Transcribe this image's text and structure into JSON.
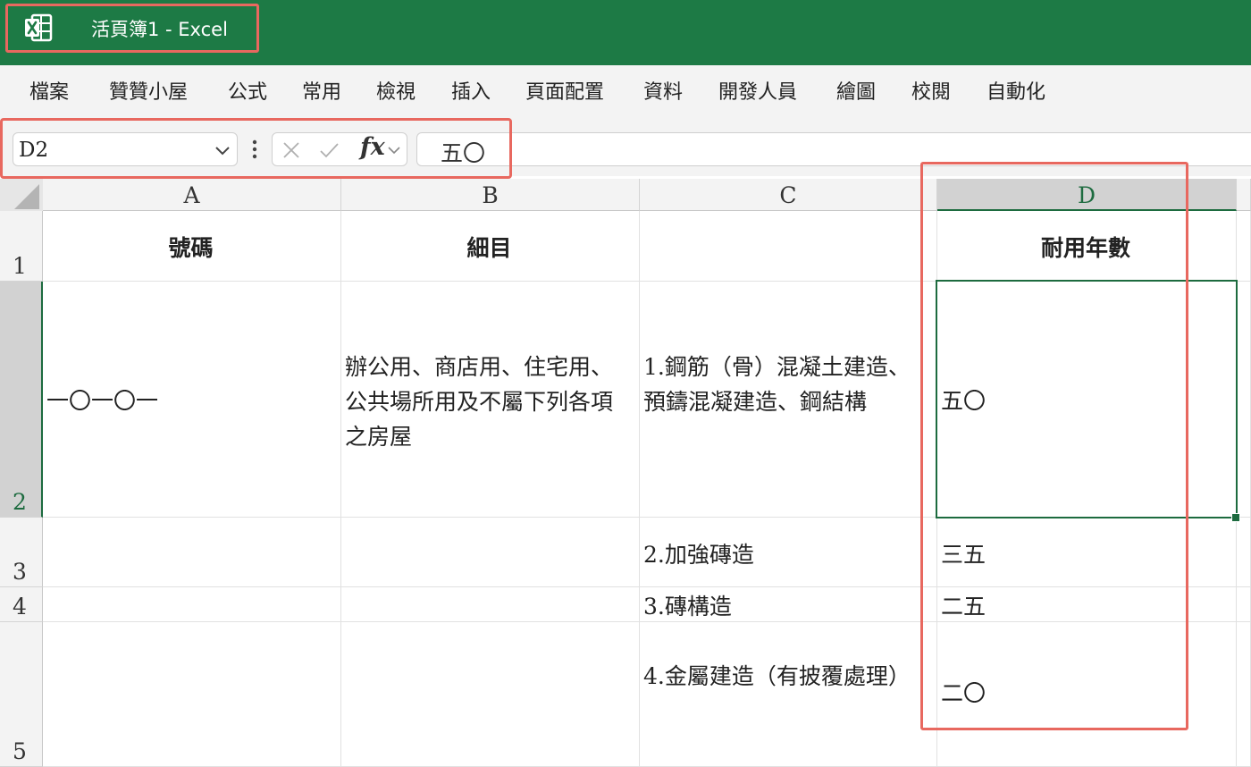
{
  "window": {
    "title": "活頁簿1  -  Excel",
    "app_icon": "excel-icon",
    "brand_color": "#1d7a45"
  },
  "menu": {
    "items": [
      "檔案",
      "贊贊小屋",
      "公式",
      "常用",
      "檢視",
      "插入",
      "頁面配置",
      "資料",
      "開發人員",
      "繪圖",
      "校閱",
      "自動化"
    ]
  },
  "formula_bar": {
    "name_box": "D2",
    "fx_label": "fx",
    "formula": "五〇"
  },
  "grid": {
    "columns": [
      "A",
      "B",
      "C",
      "D"
    ],
    "selected_column": "D",
    "rows": [
      "1",
      "2",
      "3",
      "4",
      "5"
    ],
    "selected_row": "2",
    "cells": {
      "A1": "號碼",
      "B1": "細目",
      "C1": "",
      "D1": "耐用年數",
      "A2": "一〇一〇一",
      "B2": "辦公用、商店用、住宅用、公共場所用及不屬下列各項之房屋",
      "C2": "1.鋼筋（骨）混凝土建造、 預鑄混凝建造、鋼結構",
      "D2": "五〇",
      "C3": "2.加強磚造",
      "D3": "三五",
      "C4": "3.磚構造",
      "D4": "二五",
      "C5": "4.金屬建造（有披覆處理）",
      "D5": "二〇"
    }
  },
  "highlight_color": "#e8685f",
  "selection_color": "#1d6b3f"
}
